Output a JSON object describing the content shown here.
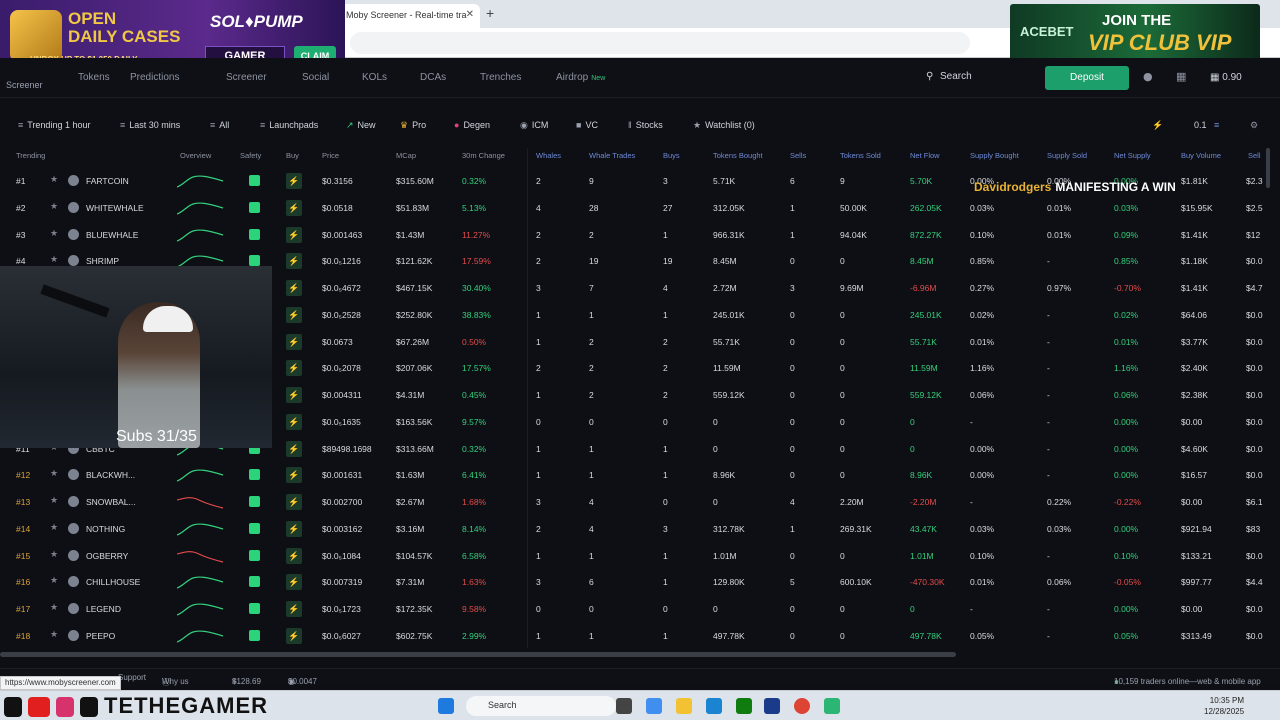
{
  "browser": {
    "tab_title": "Moby Screener - Real-time tra",
    "tab_close": "✕",
    "new_tab": "+",
    "status_url": "https://www.mobyscreener.com"
  },
  "ads": {
    "left": {
      "open": "OPEN",
      "daily": "DAILY CASES",
      "unbox": "UNBOX UP TO $1,250 DAILY",
      "brand": "SOL♦PUMP",
      "gamer": "GAMER",
      "claim": "CLAIM"
    },
    "right": {
      "brand": "ACEBET",
      "join": "JOIN THE",
      "vip": "VIP CLUB VIP"
    }
  },
  "nav": {
    "logo_sub": "Screener",
    "links": [
      "Tokens",
      "Predictions",
      "Screener",
      "Social",
      "KOLs",
      "DCAs",
      "Trenches",
      "Airdrop"
    ],
    "airdrop_badge": "New",
    "search": "Search",
    "deposit": "Deposit",
    "balance": "0.90"
  },
  "filters": {
    "buttons": [
      "Trending 1 hour",
      "Last 30 mins",
      "All",
      "Launchpads",
      "New",
      "Pro",
      "Degen",
      "ICM",
      "VC",
      "Stocks",
      "Watchlist (0)"
    ],
    "amount": "0.1"
  },
  "columns": [
    "Trending",
    "Overview",
    "Safety",
    "Buy",
    "Price",
    "MCap",
    "30m Change",
    "Whales",
    "Whale Trades",
    "Buys",
    "Tokens Bought",
    "Sells",
    "Tokens Sold",
    "Net Flow",
    "Supply Bought",
    "Supply Sold",
    "Net Supply",
    "Buy Volume",
    "Sell"
  ],
  "rows": [
    {
      "rank": "#1",
      "name": "FARTCOIN",
      "price": "$0.3156",
      "mcap": "$315.60M",
      "chg": "0.32%",
      "whales": "2",
      "wt": "9",
      "buys": "3",
      "tb": "5.71K",
      "sells": "6",
      "ts": "9",
      "nf": "5.70K",
      "sb": "0.00%",
      "ss": "0.00%",
      "ns": "0.00%",
      "bv": "$1.81K",
      "sv": "$2.3"
    },
    {
      "rank": "#2",
      "name": "WHITEWHALE",
      "price": "$0.0518",
      "mcap": "$51.83M",
      "chg": "5.13%",
      "whales": "4",
      "wt": "28",
      "buys": "27",
      "tb": "312.05K",
      "sells": "1",
      "ts": "50.00K",
      "nf": "262.05K",
      "sb": "0.03%",
      "ss": "0.01%",
      "ns": "0.03%",
      "bv": "$15.95K",
      "sv": "$2.5"
    },
    {
      "rank": "#3",
      "name": "BLUEWHALE",
      "price": "$0.001463",
      "mcap": "$1.43M",
      "chg": "11.27%",
      "whales": "2",
      "wt": "2",
      "buys": "1",
      "tb": "966.31K",
      "sells": "1",
      "ts": "94.04K",
      "nf": "872.27K",
      "sb": "0.10%",
      "ss": "0.01%",
      "ns": "0.09%",
      "bv": "$1.41K",
      "sv": "$12"
    },
    {
      "rank": "#4",
      "name": "SHRIMP",
      "price": "$0.0₅1216",
      "mcap": "$121.62K",
      "chg": "17.59%",
      "whales": "2",
      "wt": "19",
      "buys": "19",
      "tb": "8.45M",
      "sells": "0",
      "ts": "0",
      "nf": "8.45M",
      "sb": "0.85%",
      "ss": "-",
      "ns": "0.85%",
      "bv": "$1.18K",
      "sv": "$0.0"
    },
    {
      "rank": "",
      "name": "",
      "price": "$0.0₅4672",
      "mcap": "$467.15K",
      "chg": "30.40%",
      "whales": "3",
      "wt": "7",
      "buys": "4",
      "tb": "2.72M",
      "sells": "3",
      "ts": "9.69M",
      "nf": "-6.96M",
      "sb": "0.27%",
      "ss": "0.97%",
      "ns": "-0.70%",
      "bv": "$1.41K",
      "sv": "$4.7"
    },
    {
      "rank": "",
      "name": "",
      "price": "$0.0₅2528",
      "mcap": "$252.80K",
      "chg": "38.83%",
      "whales": "1",
      "wt": "1",
      "buys": "1",
      "tb": "245.01K",
      "sells": "0",
      "ts": "0",
      "nf": "245.01K",
      "sb": "0.02%",
      "ss": "-",
      "ns": "0.02%",
      "bv": "$64.06",
      "sv": "$0.0"
    },
    {
      "rank": "",
      "name": "",
      "price": "$0.0673",
      "mcap": "$67.26M",
      "chg": "0.50%",
      "whales": "1",
      "wt": "2",
      "buys": "2",
      "tb": "55.71K",
      "sells": "0",
      "ts": "0",
      "nf": "55.71K",
      "sb": "0.01%",
      "ss": "-",
      "ns": "0.01%",
      "bv": "$3.77K",
      "sv": "$0.0"
    },
    {
      "rank": "",
      "name": "",
      "price": "$0.0₅2078",
      "mcap": "$207.06K",
      "chg": "17.57%",
      "whales": "2",
      "wt": "2",
      "buys": "2",
      "tb": "11.59M",
      "sells": "0",
      "ts": "0",
      "nf": "11.59M",
      "sb": "1.16%",
      "ss": "-",
      "ns": "1.16%",
      "bv": "$2.40K",
      "sv": "$0.0"
    },
    {
      "rank": "",
      "name": "",
      "price": "$0.004311",
      "mcap": "$4.31M",
      "chg": "0.45%",
      "whales": "1",
      "wt": "2",
      "buys": "2",
      "tb": "559.12K",
      "sells": "0",
      "ts": "0",
      "nf": "559.12K",
      "sb": "0.06%",
      "ss": "-",
      "ns": "0.06%",
      "bv": "$2.38K",
      "sv": "$0.0"
    },
    {
      "rank": "",
      "name": "",
      "price": "$0.0₅1635",
      "mcap": "$163.56K",
      "chg": "9.57%",
      "whales": "0",
      "wt": "0",
      "buys": "0",
      "tb": "0",
      "sells": "0",
      "ts": "0",
      "nf": "0",
      "sb": "-",
      "ss": "-",
      "ns": "0.00%",
      "bv": "$0.00",
      "sv": "$0.0"
    },
    {
      "rank": "#11",
      "name": "CBBTC",
      "price": "$89498.1698",
      "mcap": "$313.66M",
      "chg": "0.32%",
      "whales": "1",
      "wt": "1",
      "buys": "1",
      "tb": "0",
      "sells": "0",
      "ts": "0",
      "nf": "0",
      "sb": "0.00%",
      "ss": "-",
      "ns": "0.00%",
      "bv": "$4.60K",
      "sv": "$0.0"
    },
    {
      "rank": "#12",
      "name": "BLACKWH...",
      "price": "$0.001631",
      "mcap": "$1.63M",
      "chg": "6.41%",
      "whales": "1",
      "wt": "1",
      "buys": "1",
      "tb": "8.96K",
      "sells": "0",
      "ts": "0",
      "nf": "8.96K",
      "sb": "0.00%",
      "ss": "-",
      "ns": "0.00%",
      "bv": "$16.57",
      "sv": "$0.0"
    },
    {
      "rank": "#13",
      "name": "SNOWBAL...",
      "price": "$0.002700",
      "mcap": "$2.67M",
      "chg": "1.68%",
      "whales": "3",
      "wt": "4",
      "buys": "0",
      "tb": "0",
      "sells": "4",
      "ts": "2.20M",
      "nf": "-2.20M",
      "sb": "-",
      "ss": "0.22%",
      "ns": "-0.22%",
      "bv": "$0.00",
      "sv": "$6.1"
    },
    {
      "rank": "#14",
      "name": "NOTHING",
      "price": "$0.003162",
      "mcap": "$3.16M",
      "chg": "8.14%",
      "whales": "2",
      "wt": "4",
      "buys": "3",
      "tb": "312.78K",
      "sells": "1",
      "ts": "269.31K",
      "nf": "43.47K",
      "sb": "0.03%",
      "ss": "0.03%",
      "ns": "0.00%",
      "bv": "$921.94",
      "sv": "$83"
    },
    {
      "rank": "#15",
      "name": "OGBERRY",
      "price": "$0.0₅1084",
      "mcap": "$104.57K",
      "chg": "6.58%",
      "whales": "1",
      "wt": "1",
      "buys": "1",
      "tb": "1.01M",
      "sells": "0",
      "ts": "0",
      "nf": "1.01M",
      "sb": "0.10%",
      "ss": "-",
      "ns": "0.10%",
      "bv": "$133.21",
      "sv": "$0.0"
    },
    {
      "rank": "#16",
      "name": "CHILLHOUSE",
      "price": "$0.007319",
      "mcap": "$7.31M",
      "chg": "1.63%",
      "whales": "3",
      "wt": "6",
      "buys": "1",
      "tb": "129.80K",
      "sells": "5",
      "ts": "600.10K",
      "nf": "-470.30K",
      "sb": "0.01%",
      "ss": "0.06%",
      "ns": "-0.05%",
      "bv": "$997.77",
      "sv": "$4.4"
    },
    {
      "rank": "#17",
      "name": "LEGEND",
      "price": "$0.0₅1723",
      "mcap": "$172.35K",
      "chg": "9.58%",
      "whales": "0",
      "wt": "0",
      "buys": "0",
      "tb": "0",
      "sells": "0",
      "ts": "0",
      "nf": "0",
      "sb": "-",
      "ss": "-",
      "ns": "0.00%",
      "bv": "$0.00",
      "sv": "$0.0"
    },
    {
      "rank": "#18",
      "name": "PEEPO",
      "price": "$0.0₅6027",
      "mcap": "$602.75K",
      "chg": "2.99%",
      "whales": "1",
      "wt": "1",
      "buys": "1",
      "tb": "497.78K",
      "sells": "0",
      "ts": "0",
      "nf": "497.78K",
      "sb": "0.05%",
      "ss": "-",
      "ns": "0.05%",
      "bv": "$313.49",
      "sv": "$0.0"
    }
  ],
  "stream": {
    "subs": "Subs 31/35",
    "chat_user": "Davidrodgers",
    "chat_text": "MANIFESTING A WIN"
  },
  "bottom": {
    "support": "Support",
    "why": "Why us",
    "sol_price": "$128.69",
    "token_price": "$0.0047",
    "online": "10,159 traders online—web & mobile app"
  },
  "taskbar": {
    "brand": "TETHEGAMER",
    "search": "Search",
    "time": "10:35 PM",
    "date": "12/28/2025"
  },
  "colors": {
    "positive": "#35d07c",
    "negative": "#e34b4b",
    "accent": "#1c9f6b"
  }
}
